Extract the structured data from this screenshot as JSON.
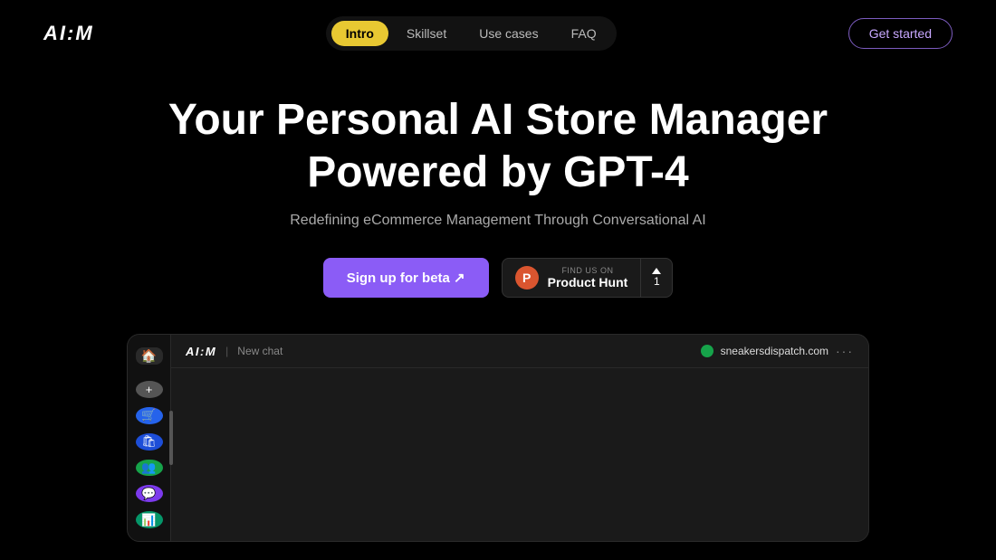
{
  "nav": {
    "logo": "AI:M",
    "links": [
      {
        "label": "Intro",
        "active": true
      },
      {
        "label": "Skillset",
        "active": false
      },
      {
        "label": "Use cases",
        "active": false
      },
      {
        "label": "FAQ",
        "active": false
      }
    ],
    "cta_label": "Get started"
  },
  "hero": {
    "headline_line1": "Your Personal AI Store Manager",
    "headline_line2": "Powered by GPT-4",
    "subtext": "Redefining eCommerce Management Through Conversational AI",
    "cta_beta": "Sign up for beta ↗",
    "ph_find": "FIND US ON",
    "ph_name": "Product Hunt",
    "ph_votes": "1"
  },
  "app_preview": {
    "logo": "AI:M",
    "separator": "|",
    "new_chat": "New chat",
    "store_name": "sneakersdispatch.com",
    "dots": "···",
    "sidebar_icons": [
      {
        "icon": "+",
        "color": "gray"
      },
      {
        "icon": "🛒",
        "color": "blue1"
      },
      {
        "icon": "🛍",
        "color": "blue2"
      },
      {
        "icon": "👥",
        "color": "green1"
      },
      {
        "icon": "💬",
        "color": "purple"
      },
      {
        "icon": "📊",
        "color": "green2"
      }
    ]
  },
  "colors": {
    "accent_yellow": "#e8c832",
    "accent_purple": "#8b5cf6",
    "background": "#000000",
    "nav_bg": "rgba(255,255,255,0.07)"
  }
}
